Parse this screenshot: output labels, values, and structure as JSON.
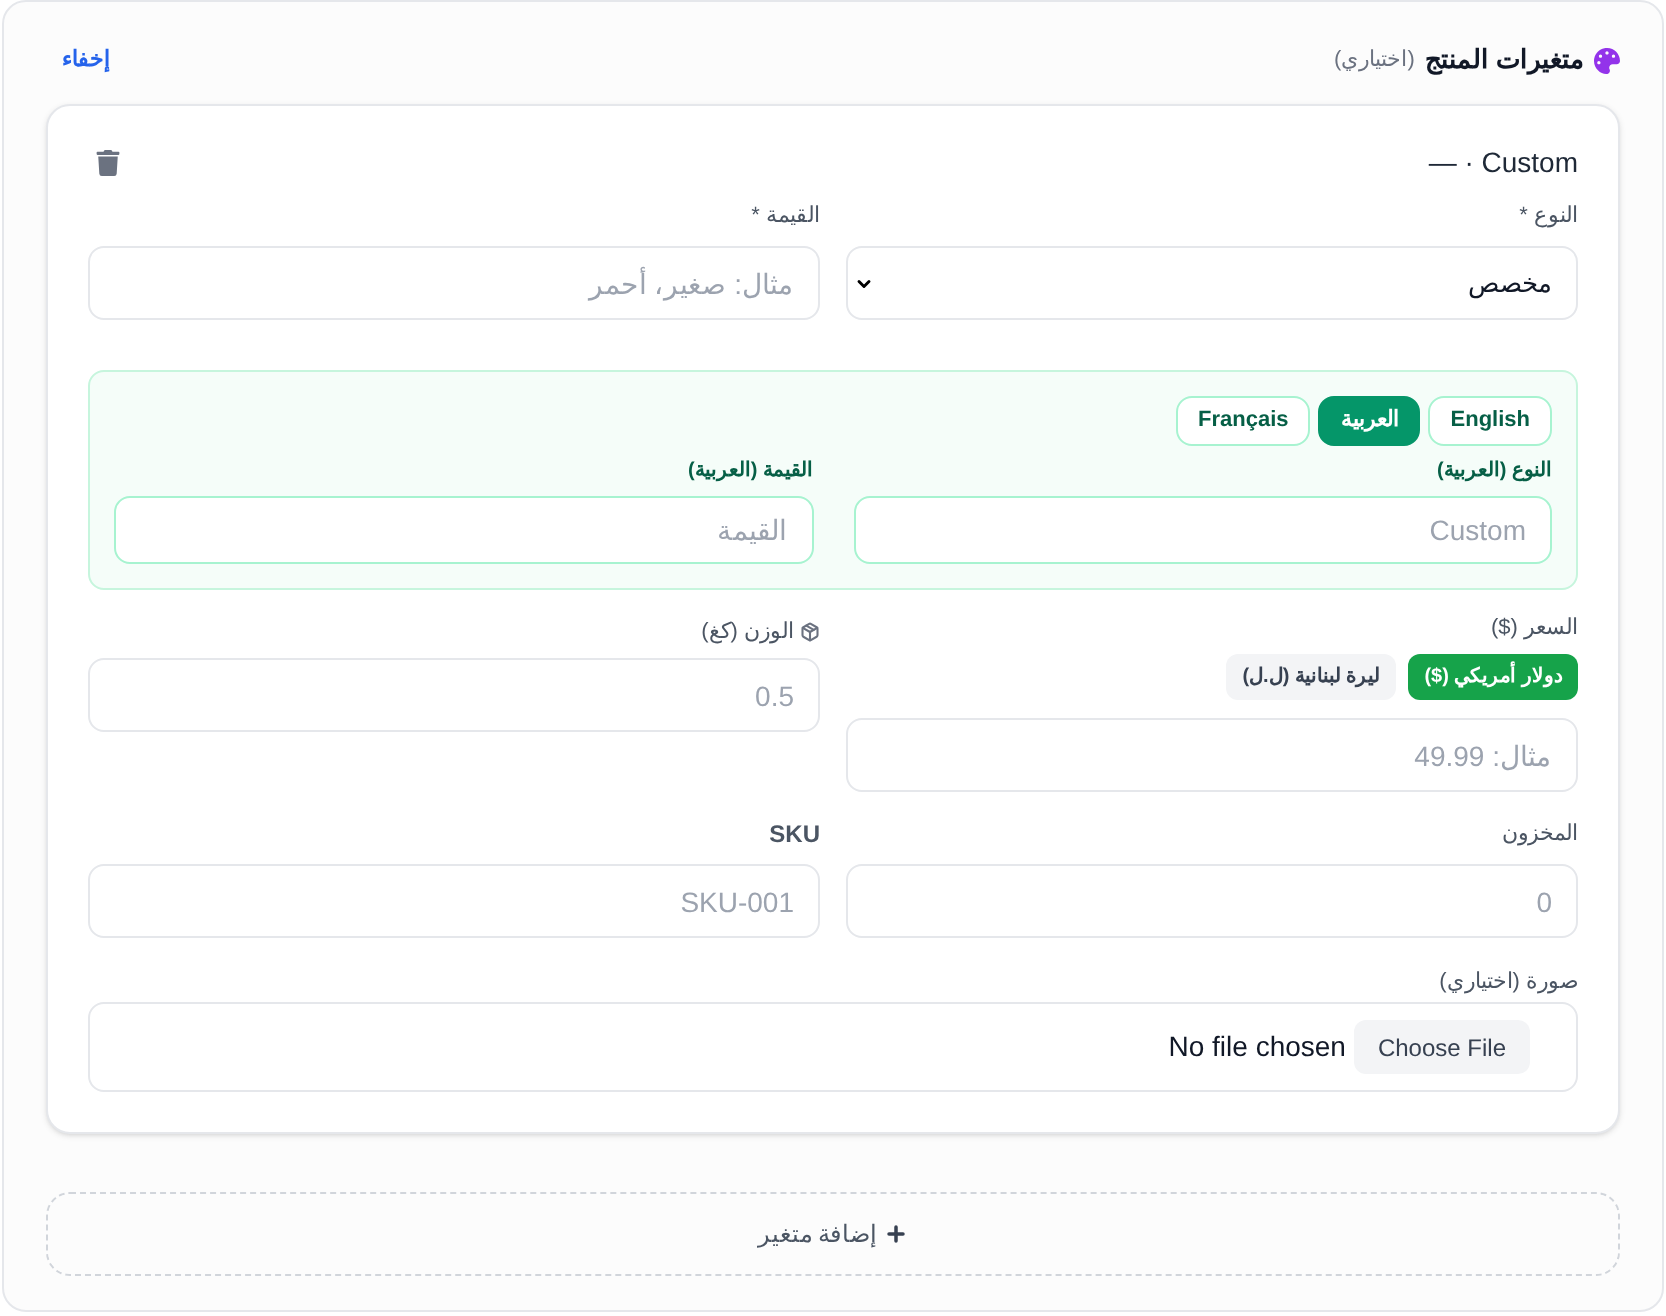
{
  "section": {
    "title": "متغيرات المنتج",
    "note": "(اختياري)",
    "hide_link": "إخفاء"
  },
  "variants": [
    {
      "heading": "Custom · —",
      "type_field": {
        "label": "النوع *",
        "value": "مخصص"
      },
      "value_field": {
        "label": "القيمة *",
        "placeholder": "مثال: صغير، أحمر"
      },
      "translations": {
        "tabs": [
          {
            "label": "English",
            "selected": false
          },
          {
            "label": "العربية",
            "selected": true
          },
          {
            "label": "Français",
            "selected": false
          }
        ],
        "type_field": {
          "label": "النوع (العربية)",
          "placeholder": "Custom"
        },
        "value_field": {
          "label": "القيمة (العربية)",
          "placeholder": "القيمة"
        }
      },
      "price": {
        "label": "السعر ($)",
        "currencies": [
          {
            "label": "دولار أمريكي ($)",
            "selected": true
          },
          {
            "label": "ليرة لبنانية (ل.ل)",
            "selected": false
          }
        ],
        "placeholder": "مثال: 49.99"
      },
      "weight": {
        "label": "الوزن (كغ)",
        "placeholder": "0.5"
      },
      "stock": {
        "label": "المخزون",
        "placeholder": "0"
      },
      "sku": {
        "label": "SKU",
        "placeholder": "SKU-001"
      },
      "image": {
        "label": "صورة (اختياري)",
        "button": "Choose File",
        "status": "No file chosen"
      }
    }
  ],
  "add_button": "إضافة متغير"
}
